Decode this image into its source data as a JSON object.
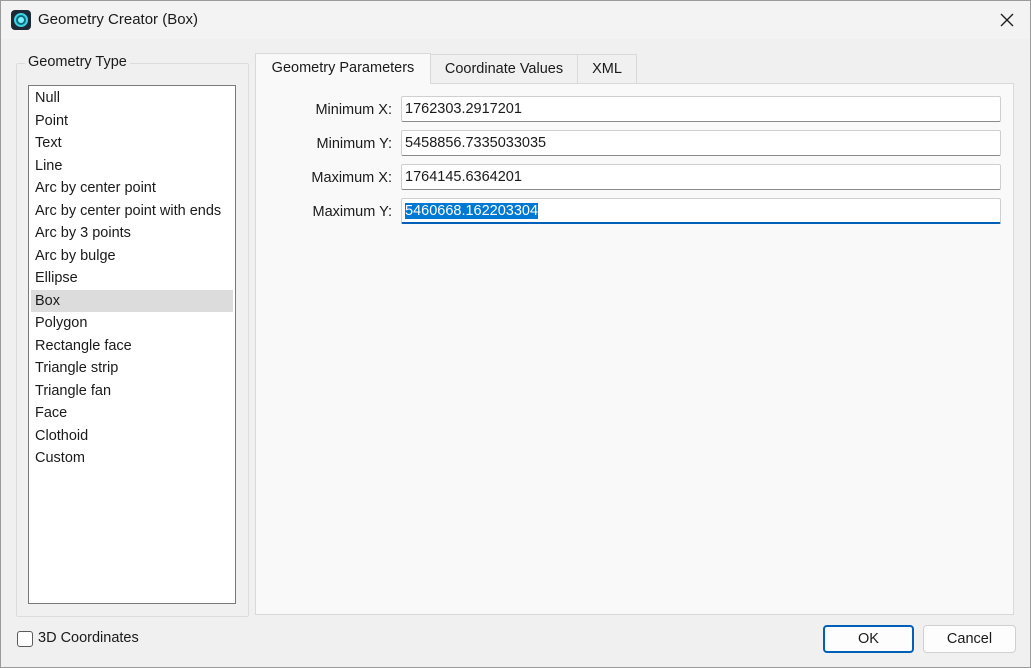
{
  "window": {
    "title": "Geometry Creator (Box)"
  },
  "geometry_type": {
    "legend": "Geometry Type",
    "items": [
      "Null",
      "Point",
      "Text",
      "Line",
      "Arc by center point",
      "Arc by center point with ends",
      "Arc by 3 points",
      "Arc by bulge",
      "Ellipse",
      "Box",
      "Polygon",
      "Rectangle face",
      "Triangle strip",
      "Triangle fan",
      "Face",
      "Clothoid",
      "Custom"
    ],
    "selected": "Box"
  },
  "tabs": [
    {
      "label": "Geometry Parameters",
      "active": true
    },
    {
      "label": "Coordinate Values",
      "active": false
    },
    {
      "label": "XML",
      "active": false
    }
  ],
  "parameters": [
    {
      "label": "Minimum X:",
      "value": "1762303.2917201"
    },
    {
      "label": "Minimum Y:",
      "value": "5458856.7335033035"
    },
    {
      "label": "Maximum X:",
      "value": "1764145.6364201"
    },
    {
      "label": "Maximum Y:",
      "value": "5460668.162203304"
    }
  ],
  "footer": {
    "checkbox_label": "3D Coordinates",
    "checkbox_checked": false,
    "ok_label": "OK",
    "cancel_label": "Cancel"
  },
  "colors": {
    "accent": "#005fb8",
    "selection_highlight": "#0078d4",
    "list_selected": "#dcdcdc"
  },
  "icons": {
    "app": "geometry-creator-app-icon",
    "close": "close-icon"
  }
}
